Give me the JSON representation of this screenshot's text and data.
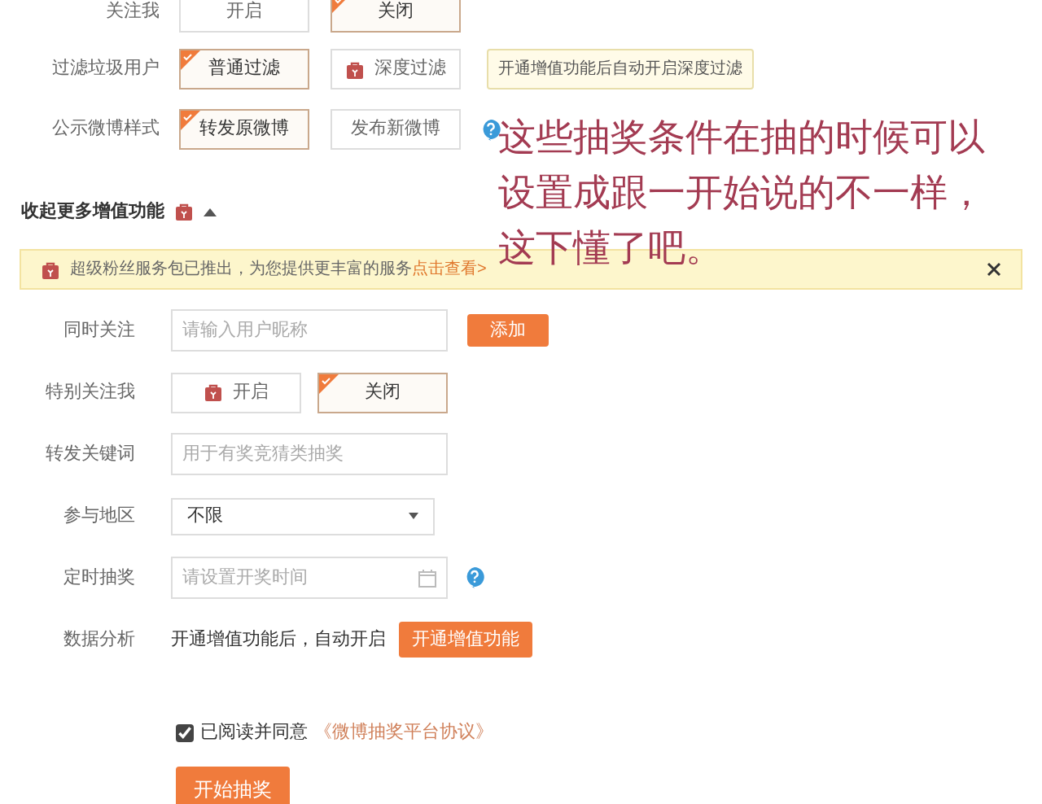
{
  "settings_top": [
    {
      "label": "关注我",
      "options": [
        {
          "label": "开启",
          "selected": false,
          "locked": false
        },
        {
          "label": "关闭",
          "selected": true,
          "locked": false
        }
      ]
    },
    {
      "label": "过滤垃圾用户",
      "options": [
        {
          "label": "普通过滤",
          "selected": true,
          "locked": false
        },
        {
          "label": "深度过滤",
          "selected": false,
          "locked": true
        }
      ],
      "tooltip": "开通增值功能后自动开启深度过滤"
    },
    {
      "label": "公示微博样式",
      "options": [
        {
          "label": "转发原微博",
          "selected": true,
          "locked": false
        },
        {
          "label": "发布新微博",
          "selected": false,
          "locked": false
        }
      ],
      "help": true
    }
  ],
  "section_toggle": {
    "label": "收起更多增值功能",
    "expanded": true
  },
  "banner": {
    "text": "超级粉丝服务包已推出，为您提供更丰富的服务",
    "link": "点击查看>"
  },
  "form_rows": [
    {
      "kind": "input",
      "label": "同时关注",
      "placeholder": "请输入用户昵称",
      "button": "添加"
    },
    {
      "kind": "options",
      "label": "特别关注我",
      "options": [
        {
          "label": "开启",
          "selected": false,
          "locked": true
        },
        {
          "label": "关闭",
          "selected": true,
          "locked": false
        }
      ]
    },
    {
      "kind": "input",
      "label": "转发关键词",
      "placeholder": "用于有奖竞猜类抽奖"
    },
    {
      "kind": "select",
      "label": "参与地区",
      "value": "不限"
    },
    {
      "kind": "date",
      "label": "定时抽奖",
      "placeholder": "请设置开奖时间",
      "help": true
    },
    {
      "kind": "text",
      "label": "数据分析",
      "text": "开通增值功能后，自动开启",
      "button": "开通增值功能"
    }
  ],
  "agreement": {
    "checked": true,
    "text": "已阅读并同意",
    "link": "《微博抽奖平台协议》"
  },
  "submit": "开始抽奖",
  "annotation": [
    "这些抽奖条件在抽的时候可以",
    "设置成跟一开始说的不一样，",
    "这下懂了吧。"
  ]
}
